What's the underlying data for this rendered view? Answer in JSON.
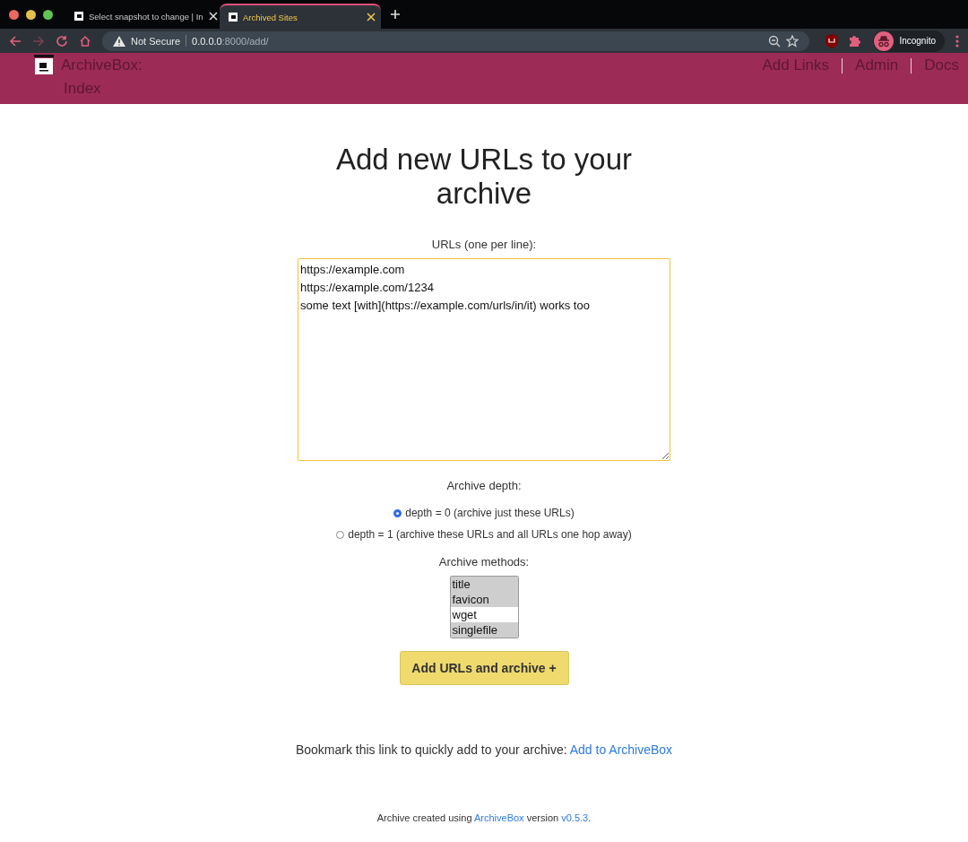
{
  "browser": {
    "tabs": [
      {
        "title": "Select snapshot to change | In",
        "selected": false
      },
      {
        "title": "Archived Sites",
        "selected": true
      }
    ],
    "security_label": "Not Secure",
    "url_host": "0.0.0.0",
    "url_path": ":8000/add/",
    "profile_label": "Incognito"
  },
  "header": {
    "brand": "ArchiveBox:",
    "subtitle": "Index",
    "nav": [
      "Add Links",
      "Admin",
      "Docs"
    ]
  },
  "form": {
    "title": "Add new URLs to your archive",
    "urls_label": "URLs (one per line):",
    "urls_value": "https://example.com\nhttps://example.com/1234\nsome text [with](https://example.com/urls/in/it) works too",
    "depth_label": "Archive depth:",
    "depth_options": [
      {
        "label": "depth = 0 (archive just these URLs)",
        "selected": true
      },
      {
        "label": "depth = 1 (archive these URLs and all URLs one hop away)",
        "selected": false
      }
    ],
    "methods_label": "Archive methods:",
    "methods": [
      {
        "label": "title",
        "selected": true
      },
      {
        "label": "favicon",
        "selected": true
      },
      {
        "label": "wget",
        "selected": false
      },
      {
        "label": "singlefile",
        "selected": true
      }
    ],
    "submit": "Add URLs and archive +"
  },
  "bookmark": {
    "text": "Bookmark this link to quickly add to your archive: ",
    "link": "Add to ArchiveBox"
  },
  "footer": {
    "before": "Archive created using ",
    "app_link": "ArchiveBox",
    "middle": " version ",
    "version_link": "v0.5.3",
    "after": "."
  }
}
